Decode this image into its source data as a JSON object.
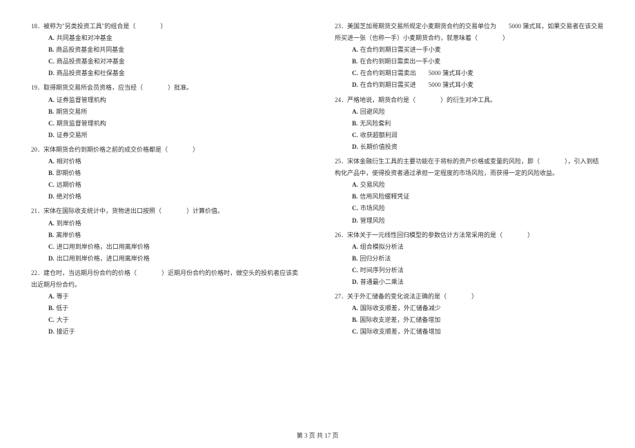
{
  "left": {
    "q18": {
      "text": "18．被称为\"另类投资工具\"的组合是（　　　　）",
      "a": "共同基金和对冲基金",
      "b": "商品投资基金和共同基金",
      "c": "商品投资基金和对冲基金",
      "d": "商品投资基金和社保基金"
    },
    "q19": {
      "text": "19．取得期货交易所会员资格，应当经（　　　　）批准。",
      "a": "证券监督管理机构",
      "b": "期货交易所",
      "c": "期货监督管理机构",
      "d": "证券交易所"
    },
    "q20": {
      "text": "20．宋体期货合约到期价格之前的成交价格都是（　　　　）",
      "a": "相对价格",
      "b": "即期价格",
      "c": "远期价格",
      "d": "绝对价格"
    },
    "q21": {
      "text": "21．宋体在国际收支统计中，货物进出口按照（　　　　）计算价值。",
      "a": "到岸价格",
      "b": "离岸价格",
      "c": "进口用到岸价格，出口用离岸价格",
      "d": "出口用到岸价格，进口用离岸价格"
    },
    "q22": {
      "text": "22．建仓时，当远期月份合约的价格（　　　　）近期月份合约的价格时，做空头的投机者应该卖",
      "cont": "出近期月份合约。",
      "a": "等于",
      "b": "低于",
      "c": "大于",
      "d": "接近于"
    }
  },
  "right": {
    "q23": {
      "text": "23．美国芝加哥期货交易所规定小麦期货合约的交易单位为　　5000 蒲式耳，如果交易者在该交易",
      "cont": "所买进一张（也称一手）小麦期货合约，就意味着（　　　　）",
      "a": "在合约到期日需买进一手小麦",
      "b": "在合约到期日需卖出一手小麦",
      "c": "在合约到期日需卖出　　5000 蒲式耳小麦",
      "d": "在合约到期日需买进　　5000 蒲式耳小麦"
    },
    "q24": {
      "text": "24．严格地说，期货合约是（　　　　）的衍生对冲工具。",
      "a": "回避风险",
      "b": "无风险套利",
      "c": "收获超额利润",
      "d": "长期价值投资"
    },
    "q25": {
      "text": "25．宋体金融衍生工具的主要功能在于将标的资产价格或变量的风险，即（　　　　），引入到结",
      "cont": "构化产品中，使得投资者通过承担一定程度的市场风险，而获得一定的风险收益。",
      "a": "交易风险",
      "b": "信用风险缓释凭证",
      "c": "市场风险",
      "d": "管理风险"
    },
    "q26": {
      "text": "26．宋体关于一元线性回归模型的参数估计方法常采用的是（　　　　）",
      "a": "组合模拟分析法",
      "b": "回归分析法",
      "c": "时间序列分析法",
      "d": "普通最小二乘法"
    },
    "q27": {
      "text": "27．关于外汇储备的变化说法正确的是（　　　　）",
      "a": "国际收支顺差，外汇储备减少",
      "b": "国际收支逆差，外汇储备增加",
      "c": "国际收支顺差，外汇储备增加"
    }
  },
  "footer": "第 3 页 共 17 页"
}
